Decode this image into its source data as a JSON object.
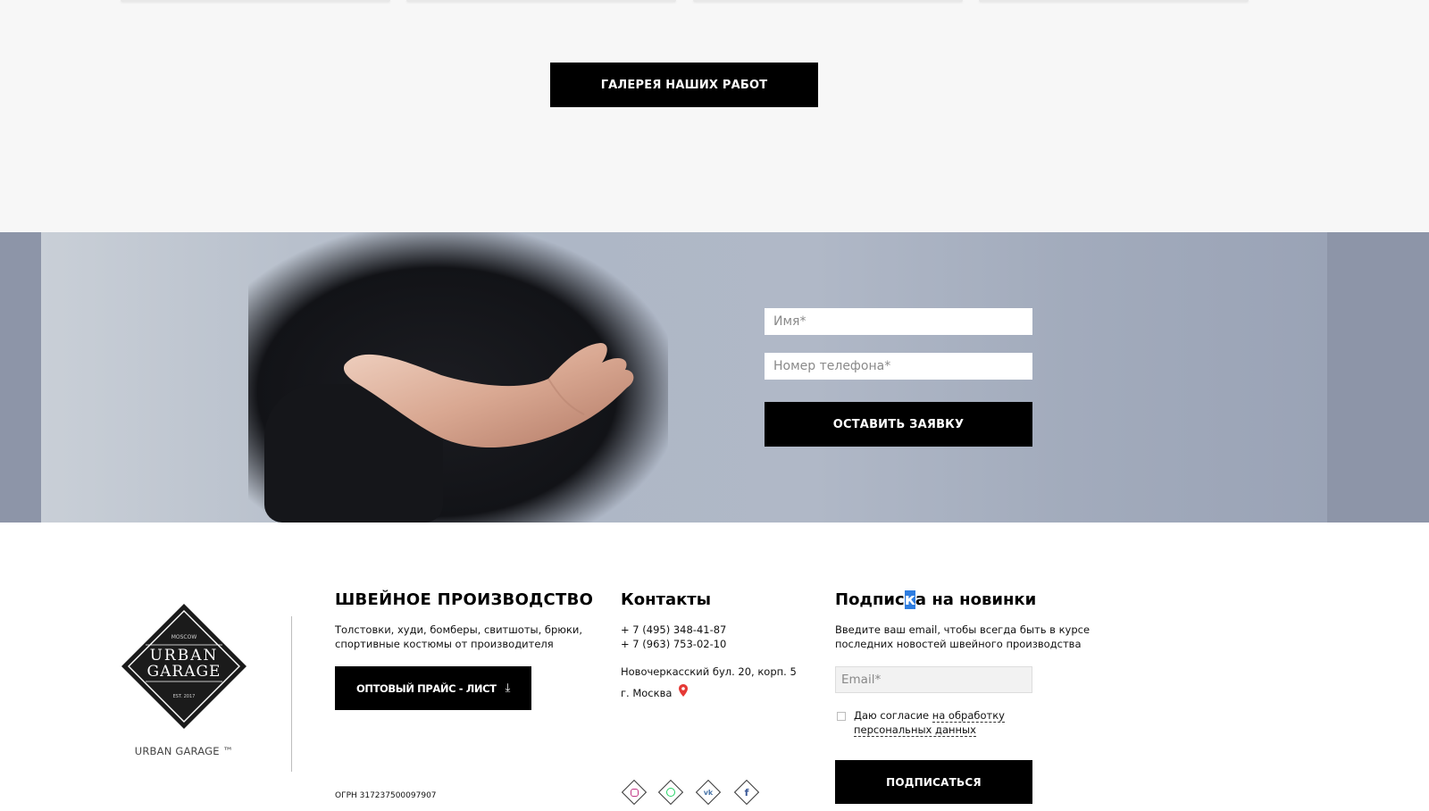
{
  "gallery": {
    "button_label": "ГАЛЕРЕЯ НАШИХ РАБОТ"
  },
  "request_form": {
    "name_placeholder": "Имя*",
    "phone_placeholder": "Номер телефона*",
    "submit_label": "ОСТАВИТЬ ЗАЯВКУ"
  },
  "footer": {
    "logo": {
      "top_text": "MOSCOW",
      "line1": "URBAN",
      "line2": "GARAGE",
      "bottom_text": "EST. 2017",
      "caption": "URBAN GARAGE ™"
    },
    "production": {
      "title": "ШВЕЙНОЕ ПРОИЗВОДСТВО",
      "description": "Толстовки, худи, бомберы, свитшоты, брюки, спортивные костюмы от производителя",
      "price_button": "ОПТОВЫЙ ПРАЙС - ЛИСТ",
      "ogrn": "ОГРН 317237500097907"
    },
    "contacts": {
      "title": "Контакты",
      "phone1": "+ 7 (495) 348-41-87",
      "phone2": "+ 7 (963) 753-02-10",
      "address_line1": "Новочеркасский бул. 20, корп. 5",
      "address_line2": "г. Москва",
      "socials": [
        "instagram-icon",
        "whatsapp-icon",
        "vk-icon",
        "facebook-icon"
      ]
    },
    "subscribe": {
      "title_part1": "Подпис",
      "title_highlight": "к",
      "title_part2": "а на новинки",
      "description": "Введите ваш email, чтобы всегда быть в курсе последних новостей швейного производства",
      "email_placeholder": "Email*",
      "agree_prefix": "Даю согласие ",
      "agree_link": "на обработку персональных данных",
      "button_label": "ПОДПИСАТЬСЯ"
    }
  },
  "colors": {
    "accent_black": "#000000",
    "selection_blue": "#2e7de0",
    "pin_red": "#e53935",
    "instagram": "#c13584",
    "whatsapp": "#25d366",
    "vk": "#4a76a8",
    "facebook": "#3b5998"
  }
}
